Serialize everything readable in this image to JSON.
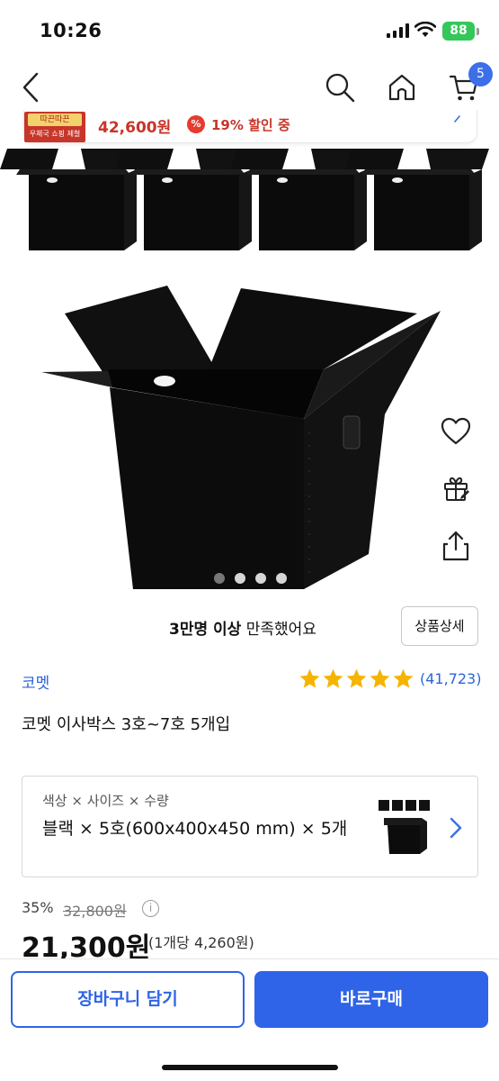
{
  "status_bar": {
    "time": "10:26",
    "battery": "88"
  },
  "nav": {
    "cart_count": "5"
  },
  "promo": {
    "badge_top": "따끈따끈",
    "badge_bottom": "우체국 쇼핑 제철",
    "price": "42,600원",
    "discount_icon": "%",
    "discount": "19% 할인 중",
    "accent_color": "#c8352a"
  },
  "gallery": {
    "dot_count": 4,
    "active_index": 0
  },
  "satisfaction": {
    "highlight": "3만명 이상",
    "text": "만족했어요"
  },
  "detail_button": "상품상세",
  "product": {
    "brand": "코멧",
    "rating_stars": 5,
    "review_count": "(41,723)",
    "title": "코멧 이사박스 3호~7호 5개입"
  },
  "option": {
    "label": "색상 × 사이즈 × 수량",
    "value": "블랙 × 5호(600x400x450 mm) × 5개"
  },
  "pricing": {
    "discount_rate": "35%",
    "original_price": "32,800원",
    "info_icon": "i",
    "sale_price": "21,300원",
    "unit_price": "(1개당 4,260원)"
  },
  "actions": {
    "cart_button": "장바구니 담기",
    "buy_button": "바로구매",
    "brand_color": "#2f64e8"
  }
}
